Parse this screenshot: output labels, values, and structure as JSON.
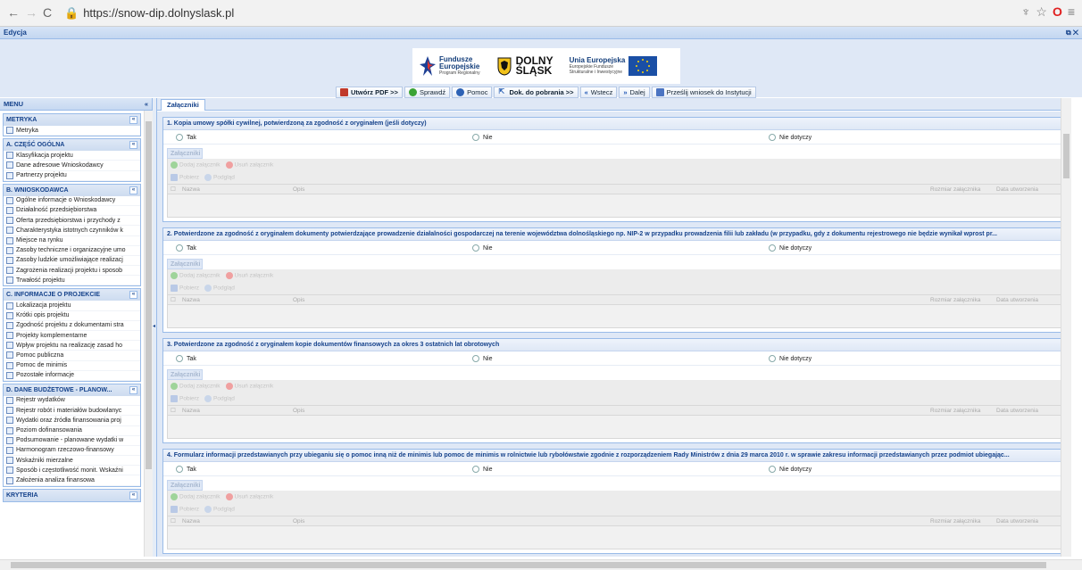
{
  "browser": {
    "back_icon": "arrow-left",
    "forward_icon": "arrow-right",
    "reload_icon": "reload",
    "url": "https://snow-dip.dolnyslask.pl"
  },
  "window": {
    "title": "Edycja",
    "controls": "⧉ ✕"
  },
  "header": {
    "fundusze_l1": "Fundusze",
    "fundusze_l2": "Europejskie",
    "fundusze_l3": "Program Regionalny",
    "dolny_l1": "DOLNY",
    "dolny_l2": "ŚLĄSK",
    "ue_l1": "Unia Europejska",
    "ue_l2": "Europejskie Fundusze",
    "ue_l3": "Strukturalne i Inwestycyjne"
  },
  "toolbar": {
    "pdf": "Utwórz PDF >>",
    "check": "Sprawdź",
    "help": "Pomoc",
    "docs": "Dok. do pobrania >>",
    "back": "Wstecz",
    "next": "Dalej",
    "send": "Prześlij wniosek do Instytucji"
  },
  "sidebar": {
    "title": "MENU",
    "collapse": "«",
    "sections": [
      {
        "title": "METRYKA",
        "items": [
          "Metryka"
        ]
      },
      {
        "title": "A. CZĘŚĆ OGÓLNA",
        "items": [
          "Klasyfikacja projektu",
          "Dane adresowe Wnioskodawcy",
          "Partnerzy projektu"
        ]
      },
      {
        "title": "B. WNIOSKODAWCA",
        "items": [
          "Ogólne informacje o Wnioskodawcy",
          "Działalność przedsiębiorstwa",
          "Oferta przedsiębiorstwa i przychody z",
          "Charakterystyka istotnych czynników k",
          "Miejsce na rynku",
          "Zasoby techniczne i organizacyjne umo",
          "Zasoby ludzkie umożliwiające realizacj",
          "Zagrożenia realizacji projektu i sposob",
          "Trwałość projektu"
        ]
      },
      {
        "title": "C. INFORMACJE O PROJEKCIE",
        "items": [
          "Lokalizacja projektu",
          "Krótki opis projektu",
          "Zgodność projektu z dokumentami stra",
          "Projekty komplementarne",
          "Wpływ projektu na realizację zasad ho",
          "Pomoc publiczna",
          "Pomoc de minimis",
          "Pozostałe informacje"
        ]
      },
      {
        "title": "D. DANE BUDŻETOWE - PLANOW...",
        "items": [
          "Rejestr wydatków",
          "Rejestr robót i materiałów budowlanyc",
          "Wydatki oraz źródła finansowania proj",
          "Poziom dofinansowania",
          "Podsumowanie - planowane wydatki w",
          "Harmonogram rzeczowo-finansowy",
          "Wskaźniki mierzalne",
          "Sposób i częstotliwość monit. Wskaźni",
          "Założenia analiza finansowa"
        ]
      },
      {
        "title": "KRYTERIA",
        "items": []
      }
    ]
  },
  "main": {
    "tab": "Załączniki",
    "radio_labels": {
      "yes": "Tak",
      "no": "Nie",
      "na": "Nie dotyczy"
    },
    "attach_label": "Załączniki",
    "add_btn": "Dodaj załącznik",
    "remove_btn": "Usuń załącznik",
    "open_btn": "Pobierz",
    "preview_btn": "Podgląd",
    "col_name": "Nazwa",
    "col_desc": "Opis",
    "col_size": "Rozmiar załącznika",
    "col_date": "Data utworzenia",
    "questions": [
      {
        "title": "1. Kopia umowy spółki cywilnej, potwierdzoną za zgodność z oryginałem (jeśli dotyczy)"
      },
      {
        "title": "2. Potwierdzone za zgodność z oryginałem dokumenty potwierdzające prowadzenie działalności gospodarczej na terenie województwa dolnośląskiego np. NIP-2 w przypadku prowadzenia filii lub zakładu (w przypadku, gdy z dokumentu rejestrowego nie będzie wynikał wprost pr..."
      },
      {
        "title": "3. Potwierdzone za zgodność z oryginałem kopie dokumentów finansowych za okres 3 ostatnich lat obrotowych"
      },
      {
        "title": "4. Formularz informacji przedstawianych przy ubieganiu się o pomoc inną niż de minimis lub pomoc de minimis w rolnictwie lub rybołówstwie zgodnie z rozporządzeniem Rady Ministrów z dnia 29 marca 2010 r. w sprawie zakresu informacji przedstawianych przez podmiot ubiegając..."
      }
    ]
  }
}
